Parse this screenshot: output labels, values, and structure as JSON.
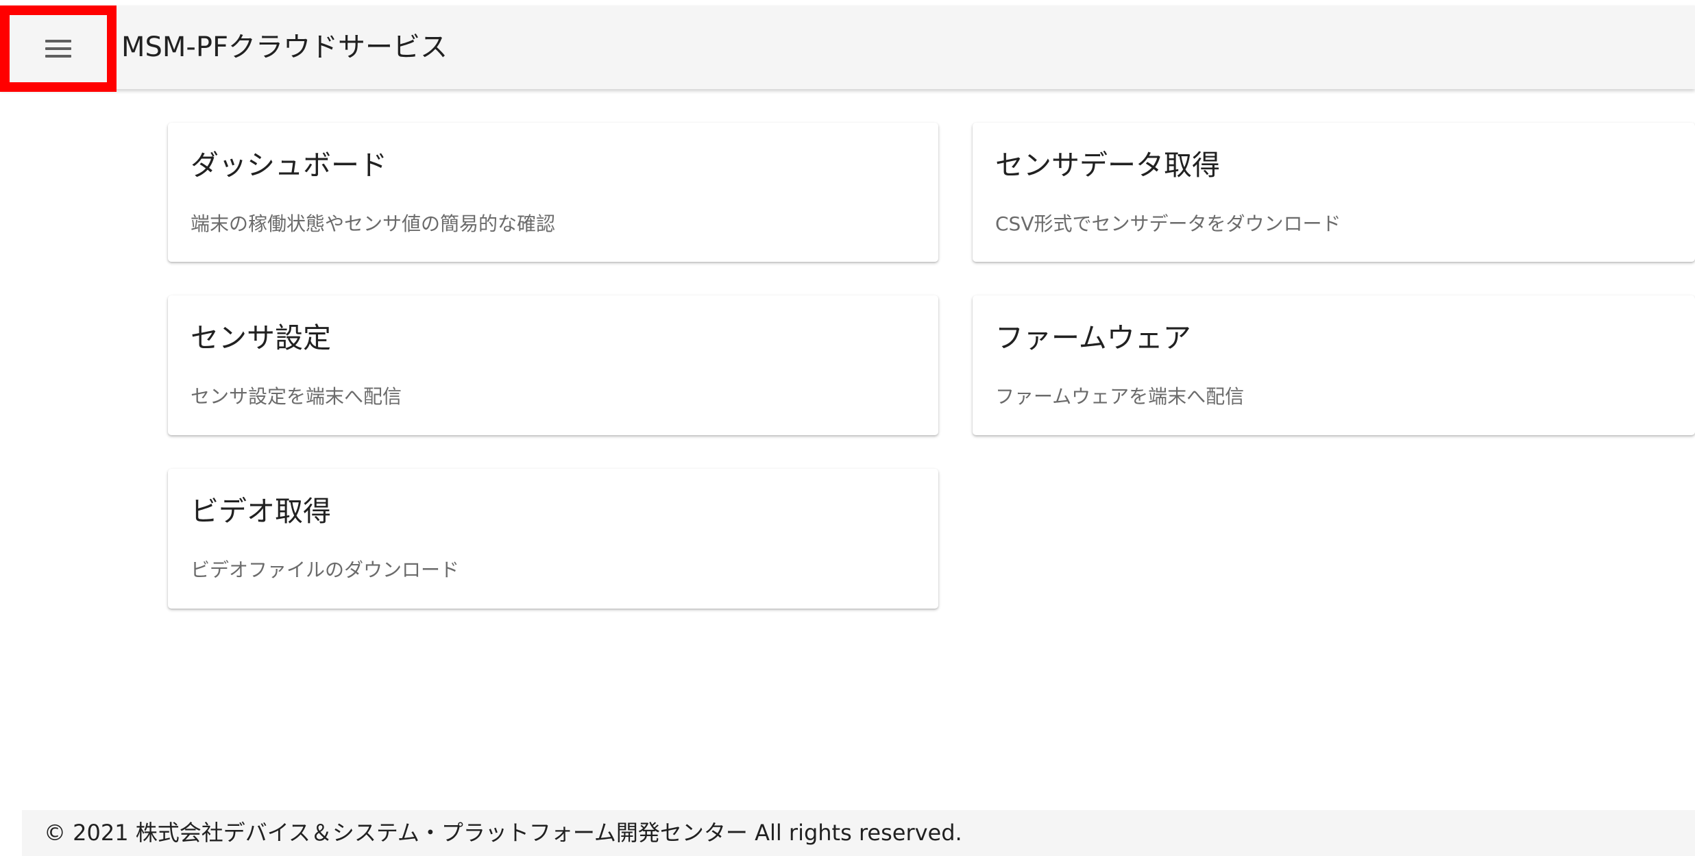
{
  "app_bar": {
    "title": "MSM-PFクラウドサービス",
    "menu_icon": "hamburger-menu-icon"
  },
  "cards": [
    {
      "title": "ダッシュボード",
      "description": "端末の稼働状態やセンサ値の簡易的な確認"
    },
    {
      "title": "センサデータ取得",
      "description": "CSV形式でセンサデータをダウンロード"
    },
    {
      "title": "センサ設定",
      "description": "センサ設定を端末へ配信"
    },
    {
      "title": "ファームウェア",
      "description": "ファームウェアを端末へ配信"
    },
    {
      "title": "ビデオ取得",
      "description": "ビデオファイルのダウンロード"
    }
  ],
  "footer": {
    "text": "© 2021 株式会社デバイス＆システム・プラットフォーム開発センター All rights reserved."
  },
  "colors": {
    "highlight": "#ff0000",
    "app_bar_bg": "#f5f5f5",
    "card_bg": "#ffffff",
    "description_text": "#6b6b6b"
  }
}
